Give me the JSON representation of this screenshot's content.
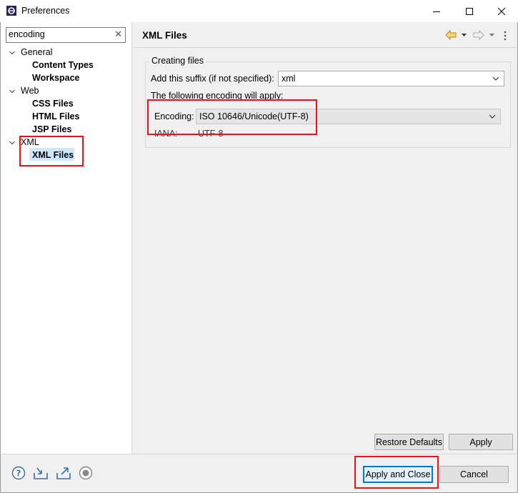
{
  "window": {
    "title": "Preferences"
  },
  "sidebar": {
    "filter_value": "encoding",
    "tree": [
      {
        "label": "General",
        "children": [
          "Content Types",
          "Workspace"
        ]
      },
      {
        "label": "Web",
        "children": [
          "CSS Files",
          "HTML Files",
          "JSP Files"
        ]
      },
      {
        "label": "XML",
        "children": [
          "XML Files"
        ]
      }
    ],
    "selected": "XML Files"
  },
  "page": {
    "title": "XML Files",
    "group_label": "Creating files",
    "suffix_label": "Add this suffix (if not specified):",
    "suffix_value": "xml",
    "encoding_note": "The following encoding will apply:",
    "encoding_label": "Encoding:",
    "encoding_value": "ISO 10646/Unicode(UTF-8)",
    "iana_label": "IANA:",
    "iana_value": "UTF-8"
  },
  "buttons": {
    "restore_defaults": "Restore Defaults",
    "apply": "Apply",
    "apply_and_close": "Apply and Close",
    "cancel": "Cancel"
  },
  "colors": {
    "highlight": "#e8141a",
    "selection": "#cce8ff",
    "focus_border": "#0078d7"
  }
}
